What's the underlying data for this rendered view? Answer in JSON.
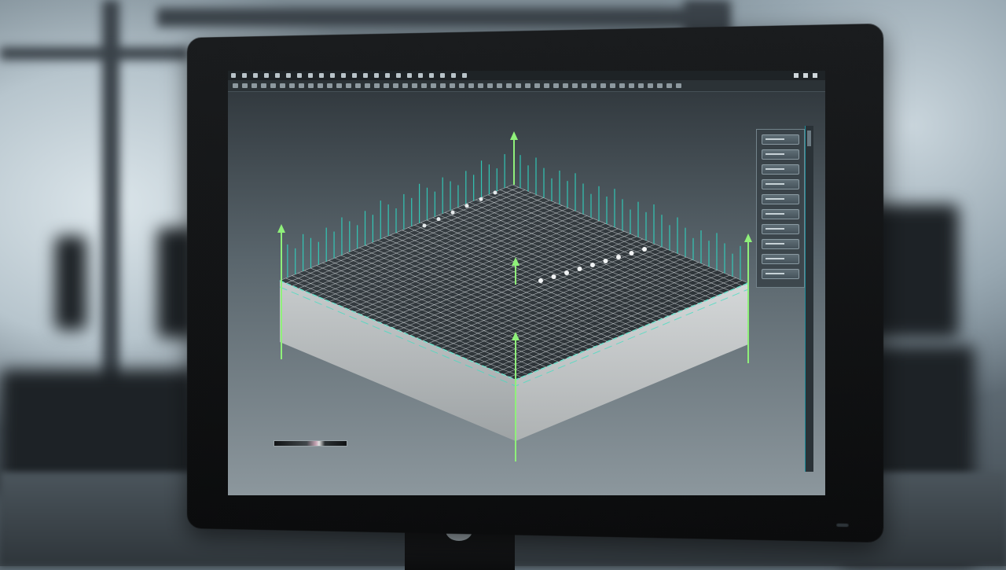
{
  "app": {
    "menubar": {
      "buttons": 22
    },
    "toolbar": {
      "buttons": 48
    },
    "window_controls": [
      "minimize",
      "maximize",
      "close"
    ]
  },
  "viewport": {
    "object": "concrete-slab-with-reinforcement-mesh",
    "axis_arrows": 5,
    "colors": {
      "mesh": "#d9dfe2",
      "rebar_spikes": "#2fd3bf",
      "axis_arrow": "#8ff07a",
      "slab_side": "#b9bdbe",
      "edge_highlight": "#38e0c0"
    }
  },
  "side_panel": {
    "buttons": 10
  },
  "legend": {
    "min_label": "",
    "max_label": ""
  },
  "icons": [
    "menu-icon",
    "tool-icon",
    "window-control-icon",
    "axis-arrow-icon"
  ]
}
